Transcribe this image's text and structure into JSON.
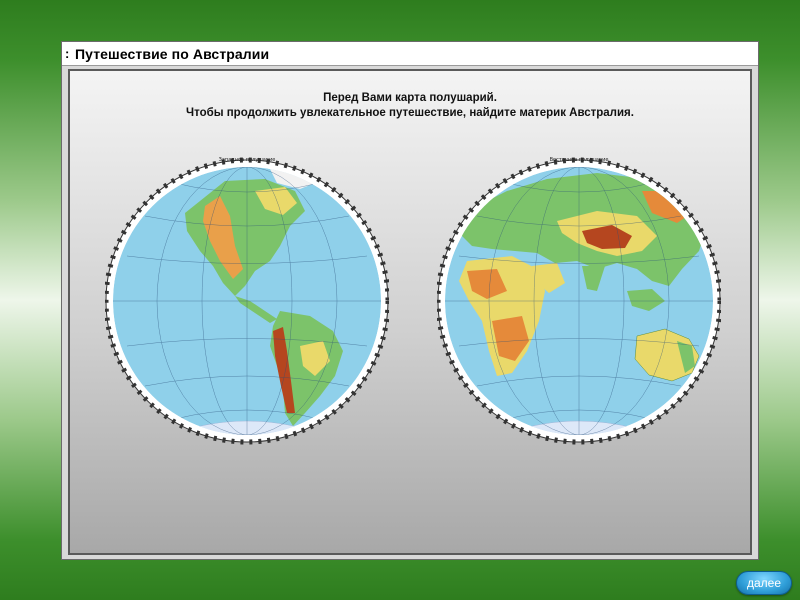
{
  "header": {
    "marker": ":",
    "title": "Путешествие по Австралии"
  },
  "instructions": {
    "line1": "Перед Вами карта полушарий.",
    "line2": "Чтобы продолжить увлекательное путешествие, найдите материк Австралия."
  },
  "maps": {
    "west_label": "Западное полушарие",
    "east_label": "Восточное полушарие"
  },
  "navigation": {
    "next_label": "далее"
  },
  "colors": {
    "ocean": "#8fd0ea",
    "land_low": "#7cc36a",
    "land_mid": "#e9d96a",
    "land_high": "#e58a3a",
    "mountain": "#b5461f",
    "ice": "#dde8f8",
    "accent_button": "#2f9ed8"
  }
}
